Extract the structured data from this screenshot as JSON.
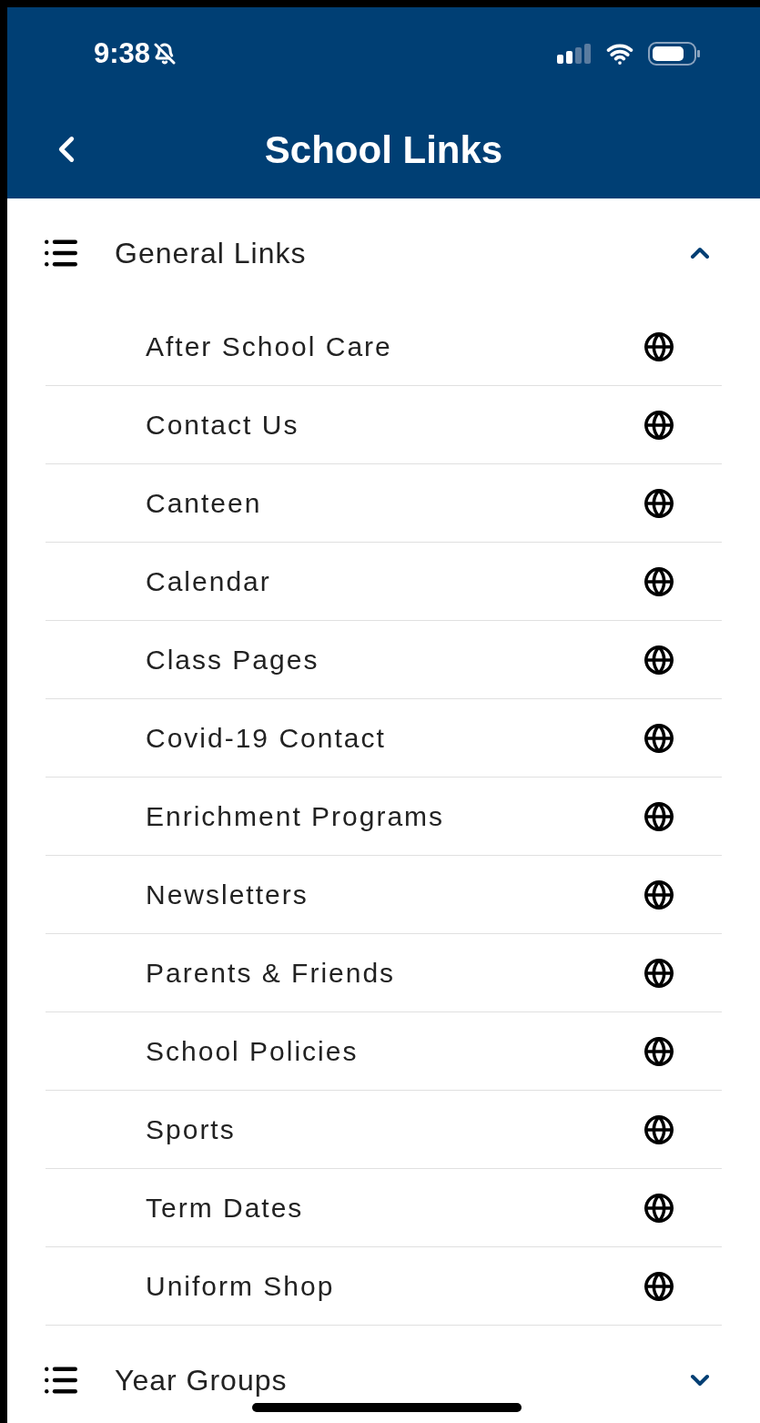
{
  "status_bar": {
    "time": "9:38"
  },
  "nav": {
    "title": "School Links"
  },
  "sections": [
    {
      "title": "General Links",
      "expanded": true,
      "items": [
        "After School Care",
        "Contact Us",
        "Canteen",
        "Calendar",
        "Class Pages",
        "Covid-19 Contact",
        "Enrichment Programs",
        "Newsletters",
        "Parents & Friends",
        "School Policies",
        "Sports",
        "Term Dates",
        "Uniform Shop"
      ]
    },
    {
      "title": "Year Groups",
      "expanded": false
    }
  ]
}
